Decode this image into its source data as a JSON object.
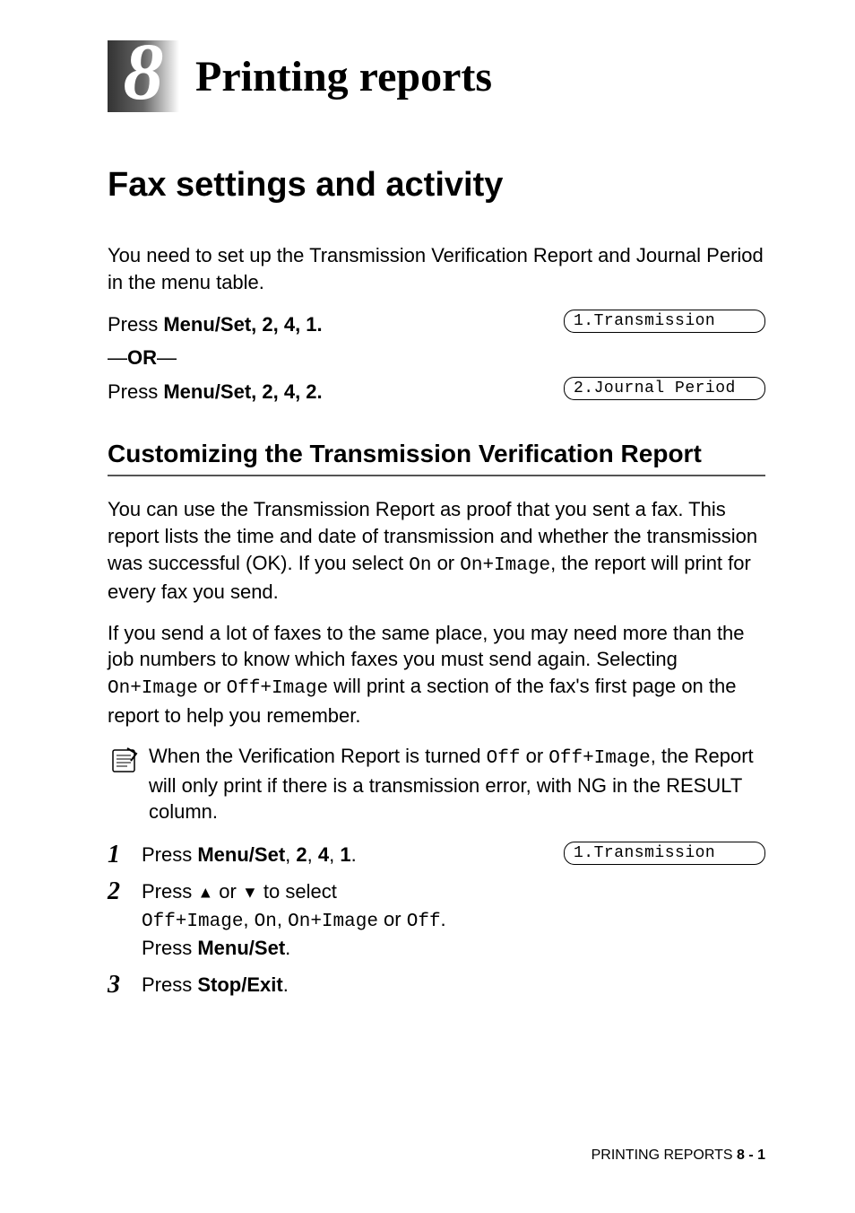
{
  "chapter": {
    "number": "8",
    "title": "Printing reports"
  },
  "section": {
    "title": "Fax settings and activity",
    "intro": "You need to set up the Transmission Verification Report and Journal Period in the menu table.",
    "press1_prefix": "Press ",
    "press1_button": "Menu/Set",
    "press1_seq": ", 2, 4, 1.",
    "or_dash": "—",
    "or_text": "OR",
    "press2_prefix": "Press ",
    "press2_button": "Menu/Set",
    "press2_seq": ", 2, 4, 2.",
    "lcd1": "1.Transmission",
    "lcd2": "2.Journal Period"
  },
  "subsection": {
    "title": "Customizing the Transmission Verification Report",
    "para1_a": "You can use the Transmission Report as proof that you sent a fax. This report lists the time and date of transmission and whether the transmission was successful (OK). If you select ",
    "para1_on": "On",
    "para1_b": " or ",
    "para1_onimage": "On+Image",
    "para1_c": ", the report will print for every fax you send.",
    "para2_a": "If you send a lot of faxes to the same place, you may need more than the job numbers to know which faxes you must send again. Selecting ",
    "para2_onimage": "On+Image",
    "para2_b": " or ",
    "para2_offimage": "Off+Image",
    "para2_c": " will print a section of the fax's first page on the report to help you remember.",
    "note_a": "When the Verification Report is turned ",
    "note_off": "Off",
    "note_b": " or ",
    "note_offimage": "Off+Image",
    "note_c": ", the Report will only print if there is a transmission error, with NG in the RESULT column.",
    "lcd_step1": "1.Transmission"
  },
  "steps": {
    "s1_num": "1",
    "s1_a": "Press ",
    "s1_btn": "Menu/Set",
    "s1_b": ", ",
    "s1_n1": "2",
    "s1_c": ", ",
    "s1_n2": "4",
    "s1_d": ", ",
    "s1_n3": "1",
    "s1_e": ".",
    "s2_num": "2",
    "s2_a": "Press ",
    "s2_up": "▲",
    "s2_b": " or ",
    "s2_down": "▼",
    "s2_c": " to select ",
    "s2_opt1": "Off+Image",
    "s2_d": ", ",
    "s2_opt2": "On",
    "s2_e": ", ",
    "s2_opt3": "On+Image",
    "s2_f": " or ",
    "s2_opt4": "Off",
    "s2_g": ".",
    "s2_press": "Press ",
    "s2_btn": "Menu/Set",
    "s2_end": ".",
    "s3_num": "3",
    "s3_a": "Press ",
    "s3_btn": "Stop/Exit",
    "s3_b": "."
  },
  "footer": {
    "text": "PRINTING REPORTS   ",
    "page": "8 - 1"
  }
}
